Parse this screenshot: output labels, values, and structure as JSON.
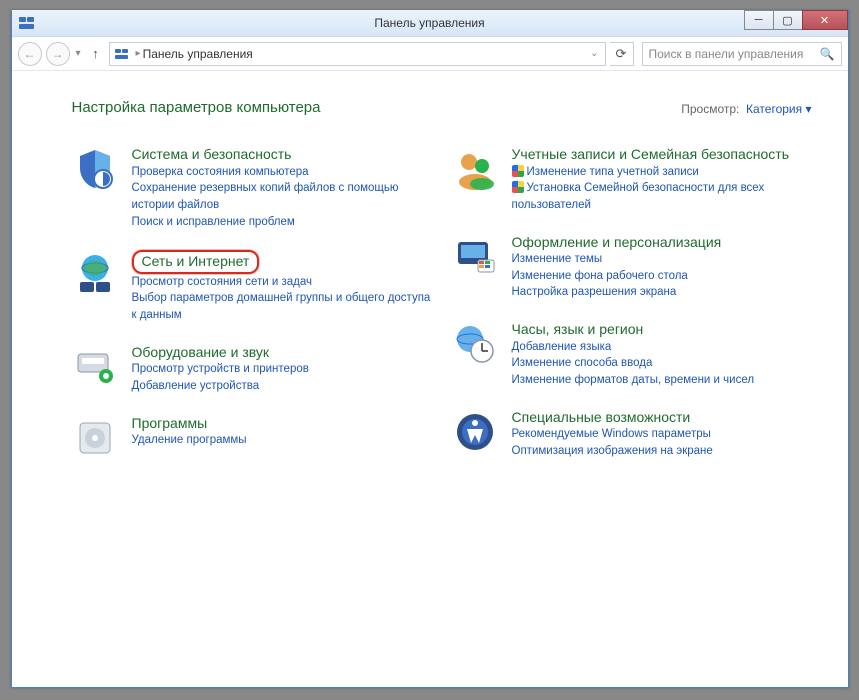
{
  "titlebar": {
    "title": "Панель управления"
  },
  "breadcrumb": {
    "path": "Панель управления"
  },
  "search": {
    "placeholder": "Поиск в панели управления"
  },
  "heading": "Настройка параметров компьютера",
  "viewby": {
    "label": "Просмотр:",
    "value": "Категория"
  },
  "left": [
    {
      "title": "Система и безопасность",
      "links": [
        "Проверка состояния компьютера",
        "Сохранение резервных копий файлов с помощью истории файлов",
        "Поиск и исправление проблем"
      ]
    },
    {
      "title": "Сеть и Интернет",
      "links": [
        "Просмотр состояния сети и задач",
        "Выбор параметров домашней группы и общего доступа к данным"
      ],
      "highlight": true
    },
    {
      "title": "Оборудование и звук",
      "links": [
        "Просмотр устройств и принтеров",
        "Добавление устройства"
      ]
    },
    {
      "title": "Программы",
      "links": [
        "Удаление программы"
      ]
    }
  ],
  "right": [
    {
      "title": "Учетные записи и Семейная безопасность",
      "links": [
        {
          "text": "Изменение типа учетной записи",
          "shield": true
        },
        {
          "text": "Установка Семейной безопасности для всех пользователей",
          "shield": true
        }
      ]
    },
    {
      "title": "Оформление и персонализация",
      "links": [
        "Изменение темы",
        "Изменение фона рабочего стола",
        "Настройка разрешения экрана"
      ]
    },
    {
      "title": "Часы, язык и регион",
      "links": [
        "Добавление языка",
        "Изменение способа ввода",
        "Изменение форматов даты, времени и чисел"
      ]
    },
    {
      "title": "Специальные возможности",
      "links": [
        "Рекомендуемые Windows параметры",
        "Оптимизация изображения на экране"
      ]
    }
  ]
}
